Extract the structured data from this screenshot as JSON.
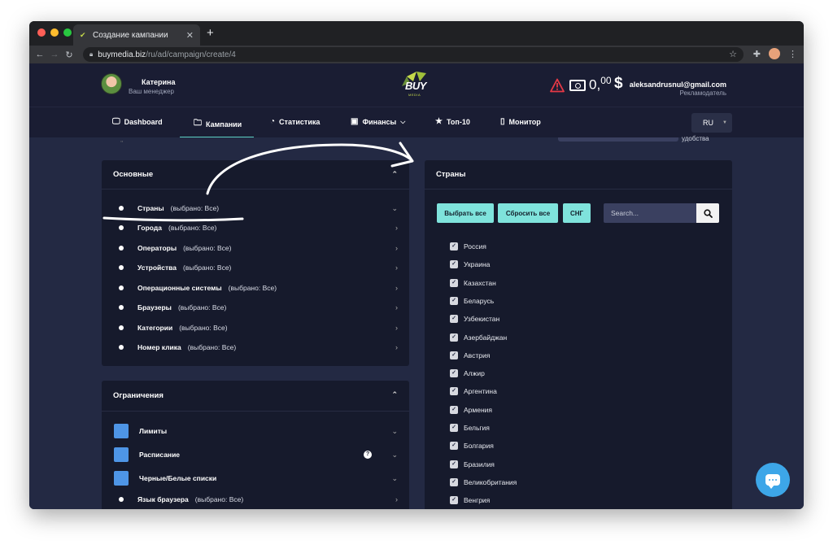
{
  "browser": {
    "tab_title": "Создание кампании",
    "url_host": "buymedia.biz",
    "url_path": "/ru/ad/campaign/create/4"
  },
  "header": {
    "user_name": "Катерина",
    "user_role": "Ваш менеджер",
    "logo_text": "BUY",
    "logo_sub": "MEDIA",
    "balance_int": "0,",
    "balance_frac": "00",
    "currency": "$",
    "email": "aleksandrusnul@gmail.com",
    "account_role": "Рекламодатель"
  },
  "nav": {
    "items": [
      {
        "label": "Dashboard",
        "icon": "monitor-icon"
      },
      {
        "label": "Кампании",
        "icon": "folder-icon"
      },
      {
        "label": "Статистика",
        "icon": "pie-chart-icon"
      },
      {
        "label": "Финансы",
        "icon": "money-icon"
      },
      {
        "label": "Топ-10",
        "icon": "star-icon"
      },
      {
        "label": "Монитор",
        "icon": "tablet-icon"
      }
    ],
    "lang": "RU"
  },
  "cut_text": "удобства",
  "panels": {
    "basic": {
      "title": "Основные",
      "items": [
        {
          "name": "Страны",
          "status": "(выбрано: Все)"
        },
        {
          "name": "Города",
          "status": "(выбрано: Все)"
        },
        {
          "name": "Операторы",
          "status": "(выбрано: Все)"
        },
        {
          "name": "Устройства",
          "status": "(выбрано: Все)"
        },
        {
          "name": "Операционные системы",
          "status": "(выбрано: Все)"
        },
        {
          "name": "Браузеры",
          "status": "(выбрано: Все)"
        },
        {
          "name": "Категории",
          "status": "(выбрано: Все)"
        },
        {
          "name": "Номер клика",
          "status": "(выбрано: Все)"
        }
      ]
    },
    "limits": {
      "title": "Ограничения",
      "items": [
        {
          "name": "Лимиты"
        },
        {
          "name": "Расписание",
          "info": "?"
        },
        {
          "name": "Черные/Белые списки"
        },
        {
          "name": "Язык браузера",
          "status": "(выбрано: Все)"
        }
      ]
    },
    "countries": {
      "title": "Страны",
      "select_all": "Выбрать все",
      "reset_all": "Сбросить все",
      "cis": "СНГ",
      "search_placeholder": "Search...",
      "list": [
        "Россия",
        "Украина",
        "Казахстан",
        "Беларусь",
        "Узбекистан",
        "Азербайджан",
        "Австрия",
        "Алжир",
        "Аргентина",
        "Армения",
        "Бельгия",
        "Болгария",
        "Бразилия",
        "Великобритания",
        "Венгрия"
      ]
    }
  },
  "colors": {
    "accent": "#7fe3dc",
    "panel": "#161a2c",
    "background": "#232943",
    "header": "#1a1d33",
    "chat": "#3da6e8",
    "square": "#4e95e6"
  }
}
